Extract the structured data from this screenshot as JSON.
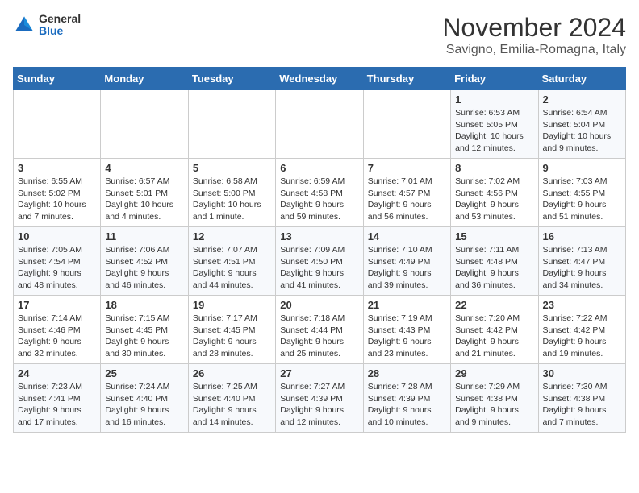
{
  "header": {
    "logo_general": "General",
    "logo_blue": "Blue",
    "month_year": "November 2024",
    "location": "Savigno, Emilia-Romagna, Italy"
  },
  "weekdays": [
    "Sunday",
    "Monday",
    "Tuesday",
    "Wednesday",
    "Thursday",
    "Friday",
    "Saturday"
  ],
  "weeks": [
    [
      {
        "day": "",
        "info": ""
      },
      {
        "day": "",
        "info": ""
      },
      {
        "day": "",
        "info": ""
      },
      {
        "day": "",
        "info": ""
      },
      {
        "day": "",
        "info": ""
      },
      {
        "day": "1",
        "info": "Sunrise: 6:53 AM\nSunset: 5:05 PM\nDaylight: 10 hours\nand 12 minutes."
      },
      {
        "day": "2",
        "info": "Sunrise: 6:54 AM\nSunset: 5:04 PM\nDaylight: 10 hours\nand 9 minutes."
      }
    ],
    [
      {
        "day": "3",
        "info": "Sunrise: 6:55 AM\nSunset: 5:02 PM\nDaylight: 10 hours\nand 7 minutes."
      },
      {
        "day": "4",
        "info": "Sunrise: 6:57 AM\nSunset: 5:01 PM\nDaylight: 10 hours\nand 4 minutes."
      },
      {
        "day": "5",
        "info": "Sunrise: 6:58 AM\nSunset: 5:00 PM\nDaylight: 10 hours\nand 1 minute."
      },
      {
        "day": "6",
        "info": "Sunrise: 6:59 AM\nSunset: 4:58 PM\nDaylight: 9 hours\nand 59 minutes."
      },
      {
        "day": "7",
        "info": "Sunrise: 7:01 AM\nSunset: 4:57 PM\nDaylight: 9 hours\nand 56 minutes."
      },
      {
        "day": "8",
        "info": "Sunrise: 7:02 AM\nSunset: 4:56 PM\nDaylight: 9 hours\nand 53 minutes."
      },
      {
        "day": "9",
        "info": "Sunrise: 7:03 AM\nSunset: 4:55 PM\nDaylight: 9 hours\nand 51 minutes."
      }
    ],
    [
      {
        "day": "10",
        "info": "Sunrise: 7:05 AM\nSunset: 4:54 PM\nDaylight: 9 hours\nand 48 minutes."
      },
      {
        "day": "11",
        "info": "Sunrise: 7:06 AM\nSunset: 4:52 PM\nDaylight: 9 hours\nand 46 minutes."
      },
      {
        "day": "12",
        "info": "Sunrise: 7:07 AM\nSunset: 4:51 PM\nDaylight: 9 hours\nand 44 minutes."
      },
      {
        "day": "13",
        "info": "Sunrise: 7:09 AM\nSunset: 4:50 PM\nDaylight: 9 hours\nand 41 minutes."
      },
      {
        "day": "14",
        "info": "Sunrise: 7:10 AM\nSunset: 4:49 PM\nDaylight: 9 hours\nand 39 minutes."
      },
      {
        "day": "15",
        "info": "Sunrise: 7:11 AM\nSunset: 4:48 PM\nDaylight: 9 hours\nand 36 minutes."
      },
      {
        "day": "16",
        "info": "Sunrise: 7:13 AM\nSunset: 4:47 PM\nDaylight: 9 hours\nand 34 minutes."
      }
    ],
    [
      {
        "day": "17",
        "info": "Sunrise: 7:14 AM\nSunset: 4:46 PM\nDaylight: 9 hours\nand 32 minutes."
      },
      {
        "day": "18",
        "info": "Sunrise: 7:15 AM\nSunset: 4:45 PM\nDaylight: 9 hours\nand 30 minutes."
      },
      {
        "day": "19",
        "info": "Sunrise: 7:17 AM\nSunset: 4:45 PM\nDaylight: 9 hours\nand 28 minutes."
      },
      {
        "day": "20",
        "info": "Sunrise: 7:18 AM\nSunset: 4:44 PM\nDaylight: 9 hours\nand 25 minutes."
      },
      {
        "day": "21",
        "info": "Sunrise: 7:19 AM\nSunset: 4:43 PM\nDaylight: 9 hours\nand 23 minutes."
      },
      {
        "day": "22",
        "info": "Sunrise: 7:20 AM\nSunset: 4:42 PM\nDaylight: 9 hours\nand 21 minutes."
      },
      {
        "day": "23",
        "info": "Sunrise: 7:22 AM\nSunset: 4:42 PM\nDaylight: 9 hours\nand 19 minutes."
      }
    ],
    [
      {
        "day": "24",
        "info": "Sunrise: 7:23 AM\nSunset: 4:41 PM\nDaylight: 9 hours\nand 17 minutes."
      },
      {
        "day": "25",
        "info": "Sunrise: 7:24 AM\nSunset: 4:40 PM\nDaylight: 9 hours\nand 16 minutes."
      },
      {
        "day": "26",
        "info": "Sunrise: 7:25 AM\nSunset: 4:40 PM\nDaylight: 9 hours\nand 14 minutes."
      },
      {
        "day": "27",
        "info": "Sunrise: 7:27 AM\nSunset: 4:39 PM\nDaylight: 9 hours\nand 12 minutes."
      },
      {
        "day": "28",
        "info": "Sunrise: 7:28 AM\nSunset: 4:39 PM\nDaylight: 9 hours\nand 10 minutes."
      },
      {
        "day": "29",
        "info": "Sunrise: 7:29 AM\nSunset: 4:38 PM\nDaylight: 9 hours\nand 9 minutes."
      },
      {
        "day": "30",
        "info": "Sunrise: 7:30 AM\nSunset: 4:38 PM\nDaylight: 9 hours\nand 7 minutes."
      }
    ]
  ]
}
